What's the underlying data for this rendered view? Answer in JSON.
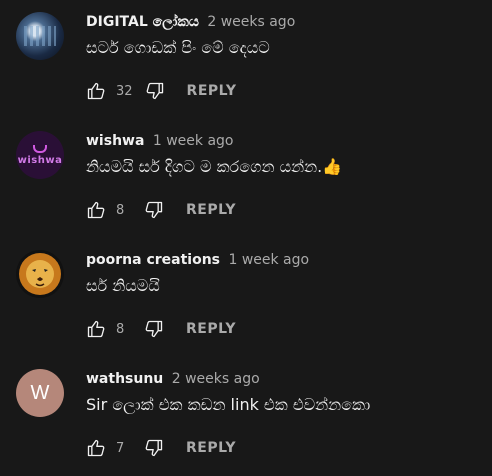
{
  "comments": [
    {
      "author": "DIGITAL ලෝකය",
      "time": "2 weeks ago",
      "text": "සර්ට ගොඩක් පිං මේ දෙයට",
      "likes": "32",
      "reply_label": "REPLY",
      "avatar": "digital-logo"
    },
    {
      "author": "wishwa",
      "time": "1 week ago",
      "text": "නියමයි සර් දිගට ම කරගෙන යන්න.👍",
      "likes": "8",
      "reply_label": "REPLY",
      "avatar": "wishwa-logo",
      "avatar_text": "wishwa"
    },
    {
      "author": "poorna creations",
      "time": "1 week ago",
      "text": "සර් නියමයි",
      "likes": "8",
      "reply_label": "REPLY",
      "avatar": "lion-logo"
    },
    {
      "author": "wathsunu",
      "time": "2 weeks ago",
      "text": "Sir ලොක් එක කඩන link එක එවන්නකො",
      "likes": "7",
      "reply_label": "REPLY",
      "avatar": "letter",
      "avatar_text": "W"
    }
  ],
  "colors": {
    "background": "#181818",
    "text_primary": "#f1f1f1",
    "text_secondary": "#aaaaaa",
    "avatar_w": "#b5877a"
  },
  "icons": {
    "like": "thumbs-up-icon",
    "dislike": "thumbs-down-icon"
  }
}
